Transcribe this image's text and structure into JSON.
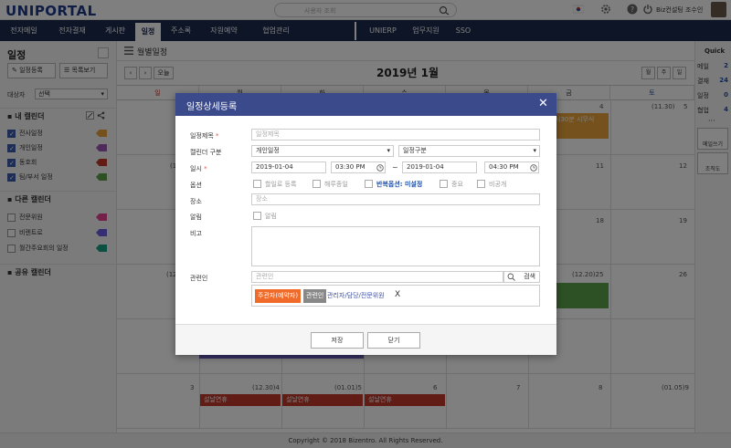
{
  "header": {
    "logo": "UNIPORTAL",
    "search_placeholder": "사용자 조회",
    "user_name": "Biz컨설팅 조수인"
  },
  "nav": {
    "items": [
      "전자메일",
      "전자결재",
      "게시판",
      "일정",
      "주소록",
      "자원예약",
      "협업관리"
    ],
    "active_index": 3,
    "right_items": [
      "UNIERP",
      "업무지원",
      "SSO"
    ]
  },
  "sidebar": {
    "title": "일정",
    "register_button": "일정등록",
    "list_button": "목록보기",
    "target_label": "대상자",
    "target_select": "선택",
    "my_calendar": "내 캘린더",
    "my_calendars": [
      {
        "label": "전사일정",
        "checked": true,
        "color": "#e8a23a"
      },
      {
        "label": "개인일정",
        "checked": true,
        "color": "#9b59b6"
      },
      {
        "label": "동호회",
        "checked": true,
        "color": "#c0392b"
      },
      {
        "label": "팀/부서 일정",
        "checked": true,
        "color": "#5aa34a"
      }
    ],
    "other_calendar": "다른 캘린더",
    "other_calendars": [
      {
        "label": "전문위원",
        "checked": false,
        "color": "#e84393"
      },
      {
        "label": "비렌트로",
        "checked": false,
        "color": "#6c5ce7"
      },
      {
        "label": "월간주요회의 일정",
        "checked": false,
        "color": "#16a085"
      }
    ],
    "shared_calendar": "공유 캘린더"
  },
  "main": {
    "view_title": "월별일정",
    "today_button": "오늘",
    "month_title": "2019년 1월",
    "view_buttons": [
      "월",
      "주",
      "일"
    ],
    "weekdays": [
      "일",
      "월",
      "화",
      "수",
      "목",
      "금",
      "토"
    ],
    "visible_cells": {
      "fri_4": "4",
      "fri_4_count": "(11.30)",
      "sat_5": "5",
      "fri_4_event": "오전 11시30분 시무식",
      "sun_row2": "(1",
      "fri_11": "11",
      "sat_12": "12",
      "fri_18": "18",
      "sat_19": "19",
      "sun_row4": "(12.",
      "fri_25": "(12.20)25",
      "sat_26": "26",
      "sun_3": "3",
      "mon_row6": "(12.30)4",
      "tue_row6": "(01.01)5",
      "wed_6": "6",
      "thu_7": "7",
      "fri_8": "8",
      "sat_9": "(01.05)9",
      "holiday": "설날연휴"
    }
  },
  "quick": {
    "title": "Quick",
    "items": [
      {
        "label": "메일",
        "count": "2"
      },
      {
        "label": "결재",
        "count": "24"
      },
      {
        "label": "일정",
        "count": "0"
      },
      {
        "label": "협업",
        "count": "4"
      }
    ],
    "more": "···",
    "mail_write": "메일쓰기",
    "org_chart": "조직도"
  },
  "footer": {
    "copyright": "Copyright © 2018 Bizentro. All Rights Reserved."
  },
  "modal": {
    "title": "일정상세등록",
    "subject_label": "일정제목",
    "subject_placeholder": "일정제목",
    "category_label": "캘린더 구분",
    "category_value": "개인일정",
    "type_value": "일정구분",
    "datetime_label": "일시",
    "start_date": "2019-01-04",
    "start_time": "03:30 PM",
    "tilde": "~",
    "end_date": "2019-01-04",
    "end_time": "04:30 PM",
    "option_label": "옵션",
    "opt_todo": "할일로 등록",
    "opt_allday": "해루종일",
    "opt_repeat": "반복옵션: 미설정",
    "opt_important": "중요",
    "opt_private": "비공개",
    "location_label": "장소",
    "location_placeholder": "장소",
    "alarm_label": "알림",
    "alarm_option": "알림",
    "memo_label": "비고",
    "attendee_label": "관련인",
    "attendee_placeholder": "관련인",
    "search_button": "검색",
    "chip_owner": "주관자(예약자)",
    "chip_related": "관련인",
    "attendee_text": "관리자/담당/전문위원",
    "remove": "X",
    "save_button": "저장",
    "close_button": "닫기"
  }
}
